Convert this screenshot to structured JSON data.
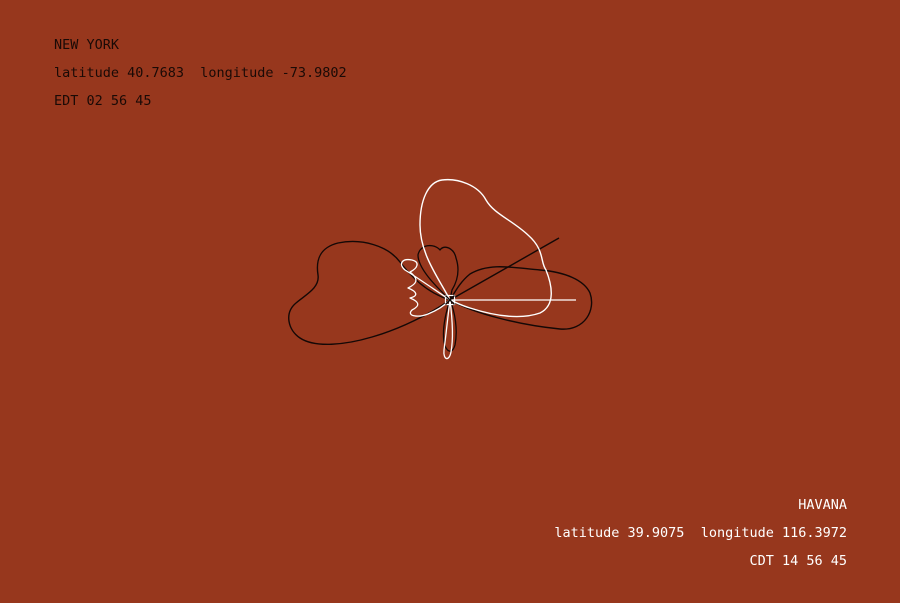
{
  "colors": {
    "background": "#97371d",
    "city_a_ink": "#1a0a06",
    "city_b_ink": "#ffffff"
  },
  "city_a": {
    "name": "NEW YORK",
    "coords": "latitude 40.7683  longitude -73.9802",
    "time": "EDT 02 56 45"
  },
  "city_b": {
    "name": "HAVANA",
    "coords": "latitude 39.9075  longitude 116.3972",
    "time": "CDT 14 56 45"
  }
}
